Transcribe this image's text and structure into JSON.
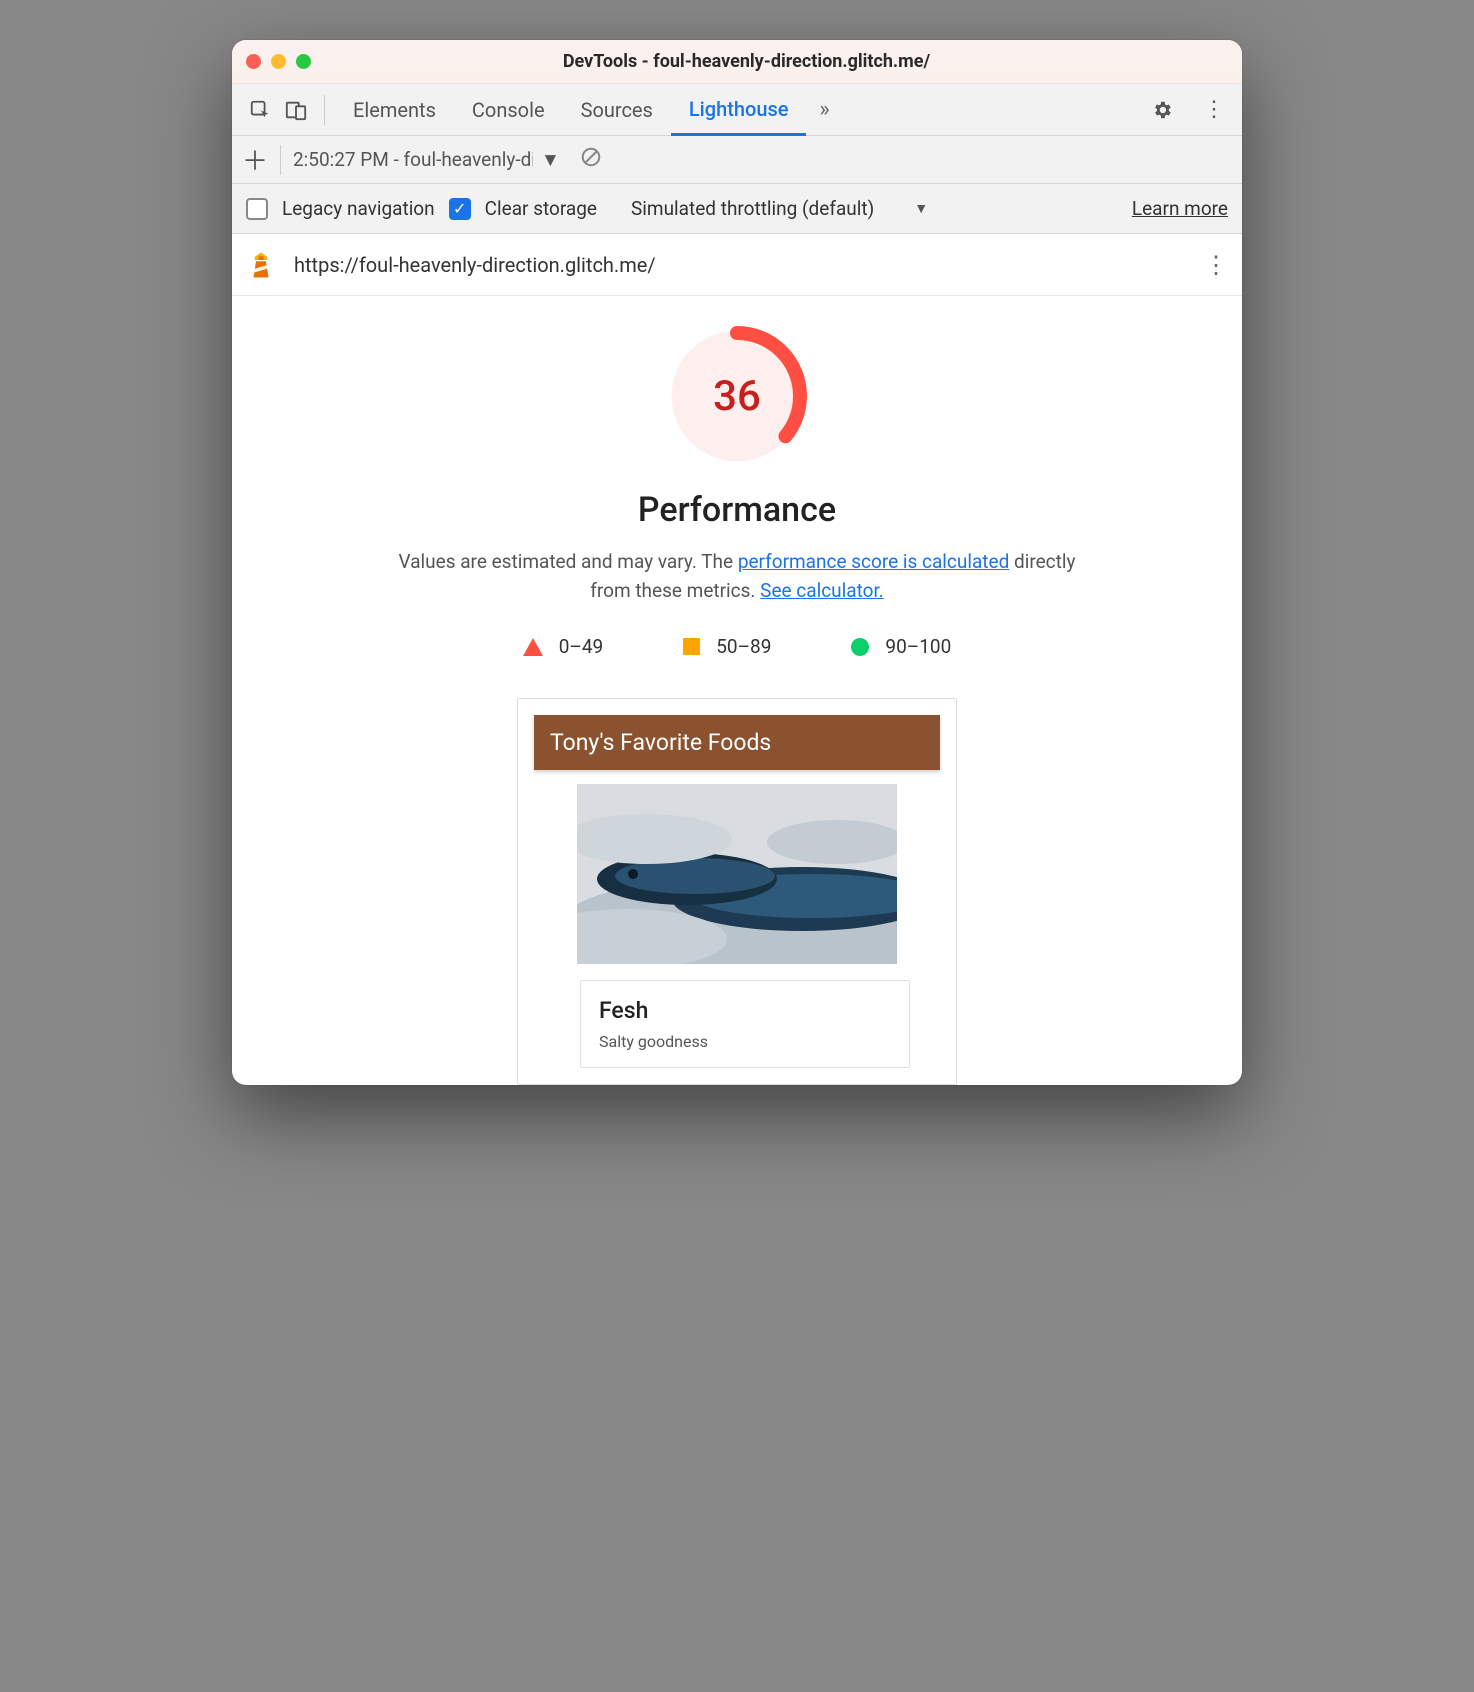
{
  "window": {
    "title": "DevTools - foul-heavenly-direction.glitch.me/"
  },
  "tabs": {
    "elements": "Elements",
    "console": "Console",
    "sources": "Sources",
    "lighthouse": "Lighthouse"
  },
  "toolbar": {
    "report_label": "2:50:27 PM - foul-heavenly-di"
  },
  "options": {
    "legacy_label": "Legacy navigation",
    "clear_label": "Clear storage",
    "throttling_label": "Simulated throttling (default)",
    "learn_more": "Learn more"
  },
  "report": {
    "url": "https://foul-heavenly-direction.glitch.me/",
    "score": "36",
    "score_value": 36,
    "category": "Performance",
    "desc_prefix": "Values are estimated and may vary. The ",
    "desc_link1": "performance score is calculated",
    "desc_mid": " directly from these metrics. ",
    "desc_link2": "See calculator.",
    "legend": {
      "fail": "0–49",
      "avg": "50–89",
      "pass": "90–100"
    }
  },
  "preview": {
    "header": "Tony's Favorite Foods",
    "item_title": "Fesh",
    "item_sub": "Salty goodness"
  },
  "colors": {
    "fail": "#ff4e42",
    "avg": "#ffa400",
    "pass": "#0cce6b",
    "link": "#1a73e8"
  }
}
